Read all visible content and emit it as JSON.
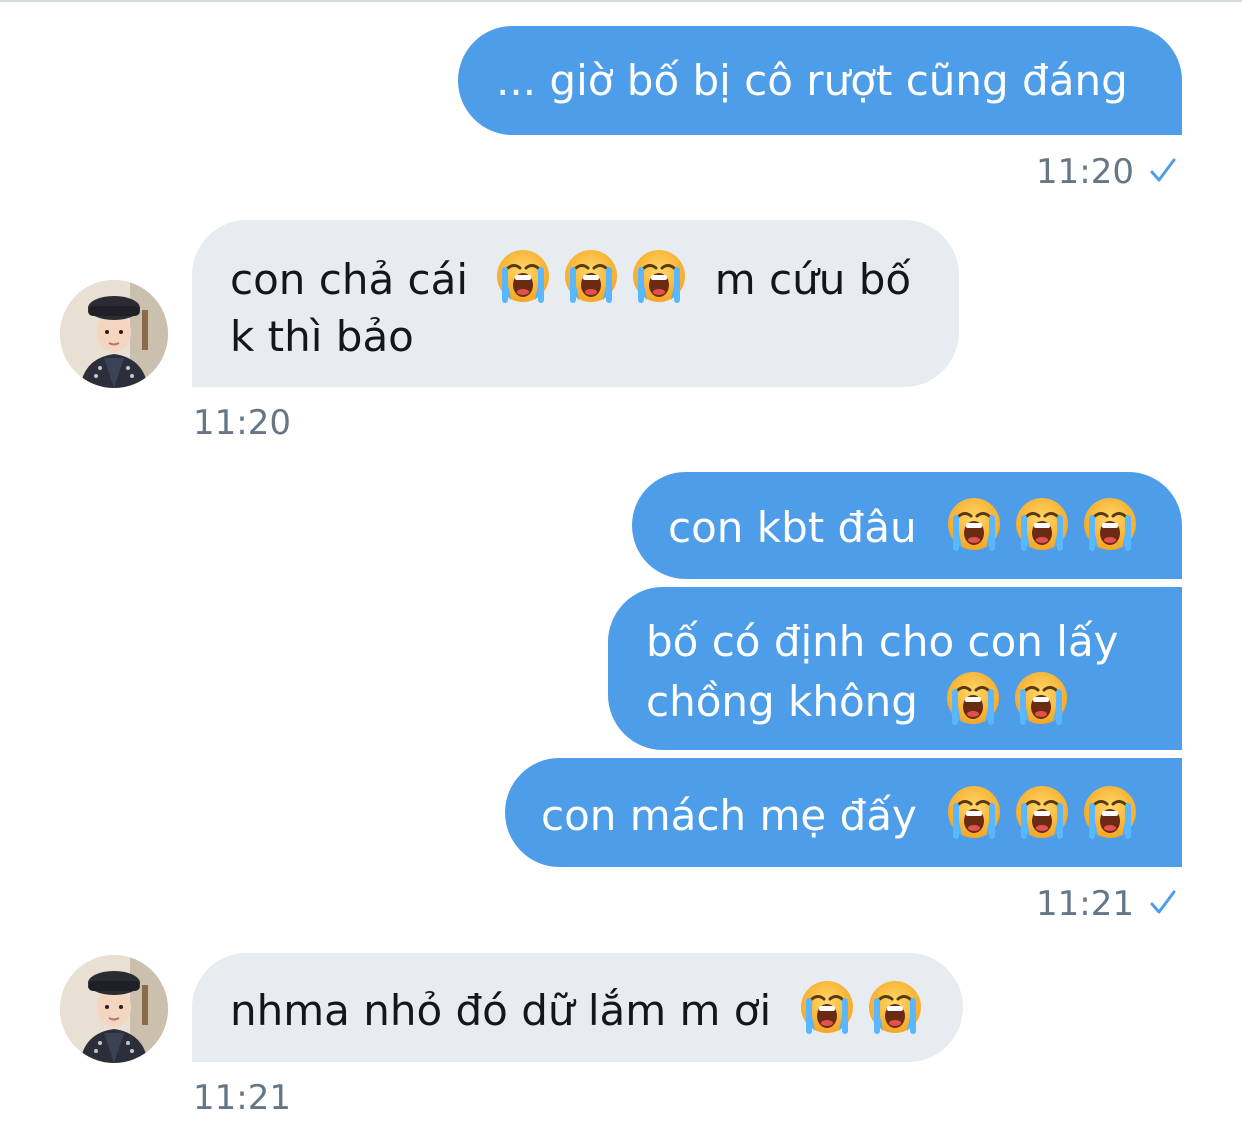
{
  "conversation": {
    "messages": [
      {
        "direction": "out",
        "text": "... giờ bố bị cô rượt cũng đáng"
      },
      {
        "direction": "in",
        "line1_a": "con chả cái",
        "line1_b": "m cứu bố",
        "line2": "k thì bảo",
        "emoji_count": 3
      },
      {
        "direction": "out",
        "text": "con kbt đâu",
        "emoji_count": 3
      },
      {
        "direction": "out",
        "line1": "bố có định cho con lấy",
        "line2": "chồng không",
        "emoji_count": 2
      },
      {
        "direction": "out",
        "text": "con mách mẹ đấy",
        "emoji_count": 3
      },
      {
        "direction": "in",
        "text": "nhma nhỏ đó dữ lắm m ơi",
        "emoji_count": 2
      }
    ],
    "timestamps": {
      "out_1": "11:20",
      "in_1": "11:20",
      "out_2": "11:21",
      "in_2": "11:21"
    },
    "emoji_name": "loudly-crying-face",
    "read_receipt_icon": "checkmark-icon"
  },
  "colors": {
    "outgoing_bubble": "#4d9de8",
    "incoming_bubble": "#e6ecf0",
    "timestamp": "#657786",
    "check": "#4d9de8"
  }
}
